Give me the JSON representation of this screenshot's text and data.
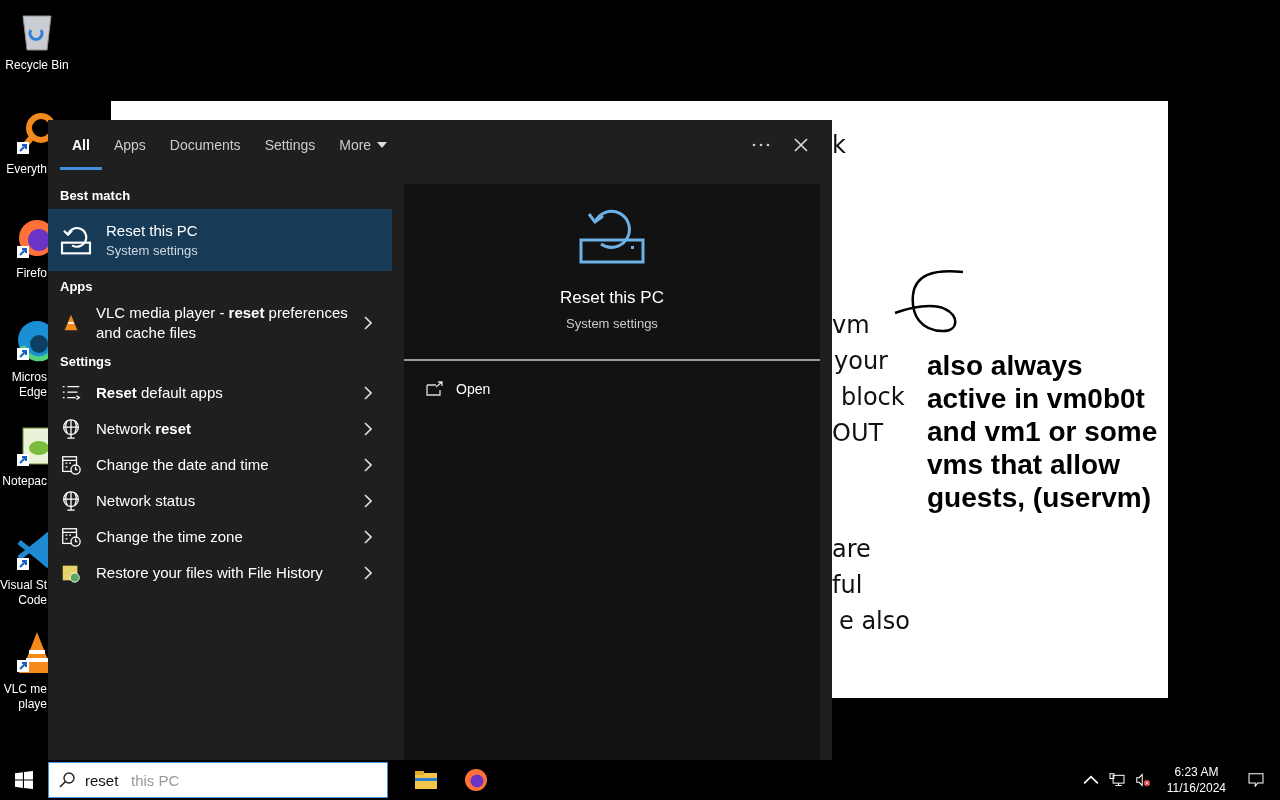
{
  "desktop_icons": [
    {
      "label": "Recycle Bin",
      "partly_hidden": false
    },
    {
      "label": "Everyth",
      "partly_hidden": true
    },
    {
      "label": "Firefo",
      "partly_hidden": true
    },
    {
      "label": "Micros\nEdge",
      "partly_hidden": true
    },
    {
      "label": "Notepac",
      "partly_hidden": true
    },
    {
      "label": "Visual St\nCode",
      "partly_hidden": true
    },
    {
      "label": "VLC me\nplaye",
      "partly_hidden": true
    }
  ],
  "document": {
    "fragments": [
      "k",
      "vm",
      "your",
      "block",
      "OUT",
      "are",
      "ful",
      "e also"
    ],
    "note": "also always active in vm0b0t and vm1 or some vms that allow guests, (uservm)"
  },
  "search_panel": {
    "tabs": [
      {
        "label": "All",
        "selected": true,
        "kind": "tab"
      },
      {
        "label": "Apps",
        "selected": false,
        "kind": "tab"
      },
      {
        "label": "Documents",
        "selected": false,
        "kind": "tab"
      },
      {
        "label": "Settings",
        "selected": false,
        "kind": "tab"
      },
      {
        "label": "More",
        "selected": false,
        "kind": "dropdown"
      }
    ],
    "sections": [
      {
        "heading": "Best match",
        "items": [
          {
            "kind": "best",
            "title": "Reset this PC",
            "subtitle": "System settings",
            "selected": true
          }
        ]
      },
      {
        "heading": "Apps",
        "items": [
          {
            "kind": "row",
            "title": "VLC media player - **reset** preferences and cache files",
            "selected": false
          }
        ]
      },
      {
        "heading": "Settings",
        "items": [
          {
            "kind": "row",
            "title": "**Reset** default apps",
            "selected": false
          },
          {
            "kind": "row",
            "title": "Network **reset**",
            "selected": false
          },
          {
            "kind": "row",
            "title": "Change the date and time",
            "selected": false
          },
          {
            "kind": "row",
            "title": "Network status",
            "selected": false
          },
          {
            "kind": "row",
            "title": "Change the time zone",
            "selected": false
          },
          {
            "kind": "row",
            "title": "Restore your files with File History",
            "selected": false
          }
        ]
      }
    ],
    "preview": {
      "title": "Reset this PC",
      "subtitle": "System settings",
      "actions": [
        "Open"
      ]
    }
  },
  "taskbar": {
    "search": {
      "value": "reset",
      "completion": "this PC"
    },
    "time": "6:23 AM",
    "date": "11/16/2024"
  }
}
